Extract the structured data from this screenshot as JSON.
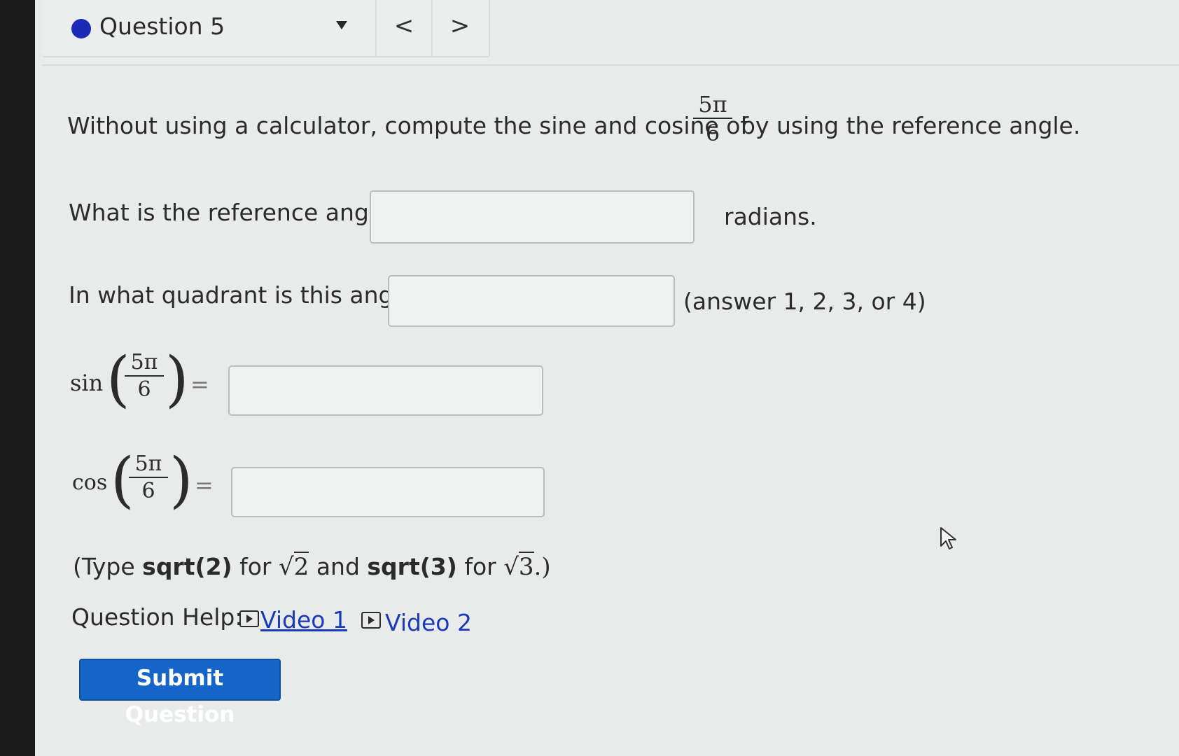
{
  "nav": {
    "question_title": "Question 5",
    "prev_label": "<",
    "next_label": ">"
  },
  "prompt": {
    "text_before": "Without using a calculator, compute the sine and cosine of",
    "frac_num": "5π",
    "frac_den": "6",
    "text_after": "by using the reference angle."
  },
  "reference": {
    "label": "What is the reference angle?",
    "value": "",
    "suffix": "radians."
  },
  "quadrant": {
    "label": "In what quadrant is this angle?",
    "value": "",
    "suffix": "(answer 1, 2, 3, or 4)"
  },
  "sine": {
    "fn": "sin",
    "num": "5π",
    "den": "6",
    "eq": "=",
    "value": ""
  },
  "cosine": {
    "fn": "cos",
    "num": "5π",
    "den": "6",
    "eq": "=",
    "value": ""
  },
  "hint": {
    "open": "(Type",
    "code1": "sqrt(2)",
    "for1": "for",
    "root1": "2",
    "and": "and",
    "code2": "sqrt(3)",
    "for2": "for",
    "root2": "3",
    "close": ".)"
  },
  "help": {
    "label": "Question Help:",
    "video1": "Video 1",
    "video2": "Video 2"
  },
  "submit_label": "Submit Question",
  "colors": {
    "accent": "#1565c8",
    "link": "#1a3bb8",
    "dot": "#1b2bb5"
  }
}
